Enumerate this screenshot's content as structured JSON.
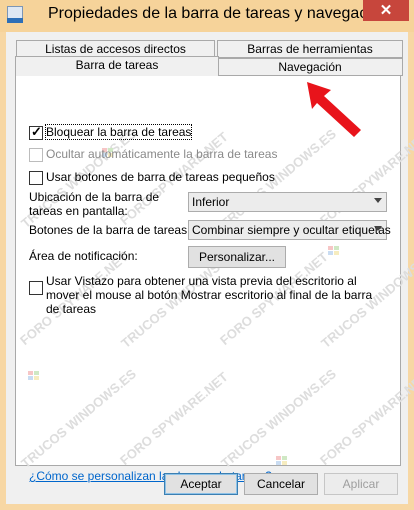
{
  "window": {
    "title": "Propiedades de la barra de tareas y navegación",
    "close_symbol": "✕"
  },
  "tabs": {
    "jump_lists": "Listas de accesos directos",
    "toolbars": "Barras de herramientas",
    "taskbar": "Barra de tareas",
    "navigation": "Navegación"
  },
  "options": {
    "lock_taskbar": "Bloquear la barra de tareas",
    "auto_hide": "Ocultar automáticamente la barra de tareas",
    "small_buttons": "Usar botones de barra de tareas pequeños",
    "peek": "Usar Vistazo para obtener una vista previa del escritorio al mover el mouse al botón Mostrar escritorio al final de la barra de tareas"
  },
  "location": {
    "label": "Ubicación de la barra de tareas en pantalla:",
    "value": "Inferior"
  },
  "buttons_combine": {
    "label": "Botones de la barra de tareas:",
    "value": "Combinar siempre y ocultar etiquetas"
  },
  "notification": {
    "label": "Área de notificación:",
    "button": "Personalizar..."
  },
  "help_link": "¿Cómo se personalizan las barras de tareas?",
  "footer": {
    "ok": "Aceptar",
    "cancel": "Cancelar",
    "apply": "Aplicar"
  },
  "watermark": {
    "text": "TRUCOS WINDOWS.ES",
    "text2": "FORO SPYWARE.NET"
  },
  "state": {
    "lock_checked": true,
    "auto_hide_checked": false,
    "auto_hide_enabled": false,
    "small_checked": false,
    "peek_checked": false,
    "apply_enabled": false
  }
}
